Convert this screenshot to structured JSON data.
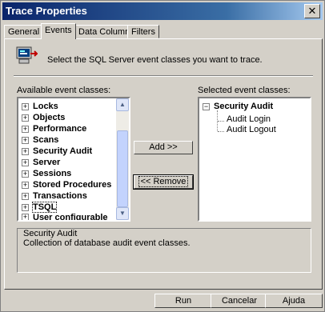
{
  "window": {
    "title": "Trace Properties",
    "close_glyph": "✕"
  },
  "tabs": [
    {
      "label": "General"
    },
    {
      "label": "Events"
    },
    {
      "label": "Data Columns"
    },
    {
      "label": "Filters"
    }
  ],
  "header": {
    "text": "Select the SQL Server event classes you want to trace.",
    "icon": "trace-events-icon"
  },
  "available": {
    "label": "Available event classes:",
    "items": [
      {
        "label": "Locks"
      },
      {
        "label": "Objects"
      },
      {
        "label": "Performance"
      },
      {
        "label": "Scans"
      },
      {
        "label": "Security Audit"
      },
      {
        "label": "Server"
      },
      {
        "label": "Sessions"
      },
      {
        "label": "Stored Procedures"
      },
      {
        "label": "Transactions"
      },
      {
        "label": "TSQL"
      },
      {
        "label": "User configurable"
      }
    ],
    "selected_item": "TSQL"
  },
  "selected": {
    "label": "Selected event classes:",
    "parent": "Security Audit",
    "children": [
      "Audit Login",
      "Audit Logout"
    ]
  },
  "buttons": {
    "add": "Add >>",
    "remove": "<< Remove",
    "run": "Run",
    "cancel": "Cancelar",
    "help": "Ajuda"
  },
  "description": {
    "title": "Security Audit",
    "text": "Collection of database audit event classes."
  },
  "glyphs": {
    "plus": "+",
    "minus": "−",
    "up": "▲",
    "down": "▼"
  }
}
